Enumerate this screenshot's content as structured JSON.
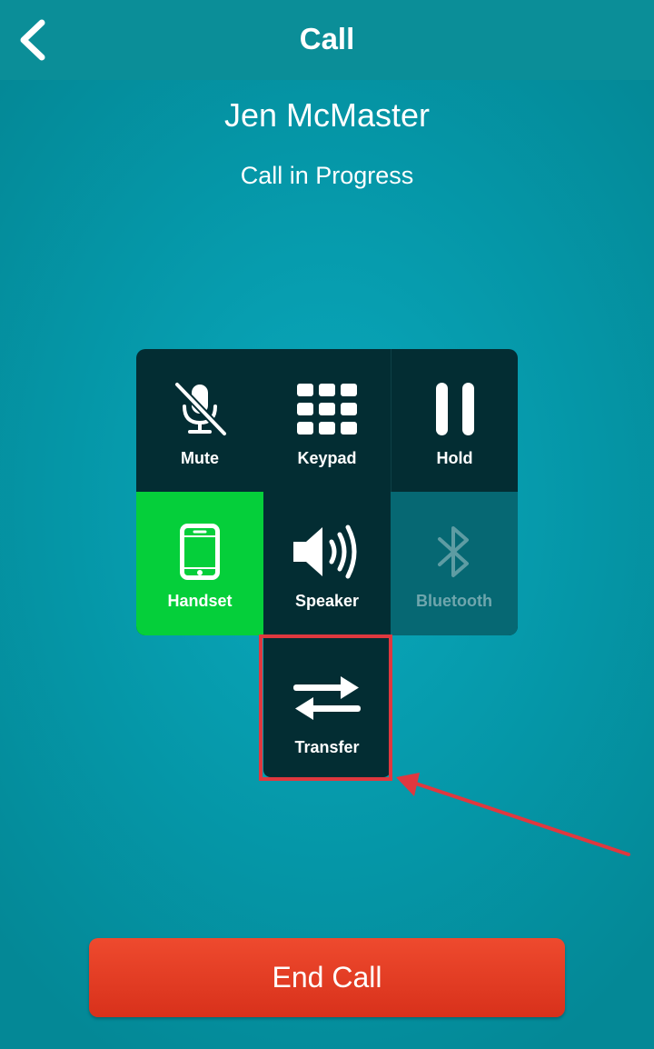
{
  "header": {
    "title": "Call",
    "back_icon": "chevron-left-icon"
  },
  "call": {
    "caller_name": "Jen McMaster",
    "status": "Call in Progress"
  },
  "controls": [
    {
      "label": "Mute",
      "icon": "microphone-muted-icon"
    },
    {
      "label": "Keypad",
      "icon": "keypad-grid-icon"
    },
    {
      "label": "Hold",
      "icon": "pause-icon"
    },
    {
      "label": "Handset",
      "icon": "phone-handset-icon",
      "active": true,
      "color": "#05cf3a"
    },
    {
      "label": "Speaker",
      "icon": "speaker-icon"
    },
    {
      "label": "Bluetooth",
      "icon": "bluetooth-icon",
      "disabled": true
    }
  ],
  "transfer": {
    "label": "Transfer",
    "icon": "transfer-arrows-icon"
  },
  "end_call": {
    "label": "End Call",
    "color": "#e03d24"
  },
  "annotation": {
    "highlight_color": "#e0383f",
    "target": "Transfer"
  }
}
